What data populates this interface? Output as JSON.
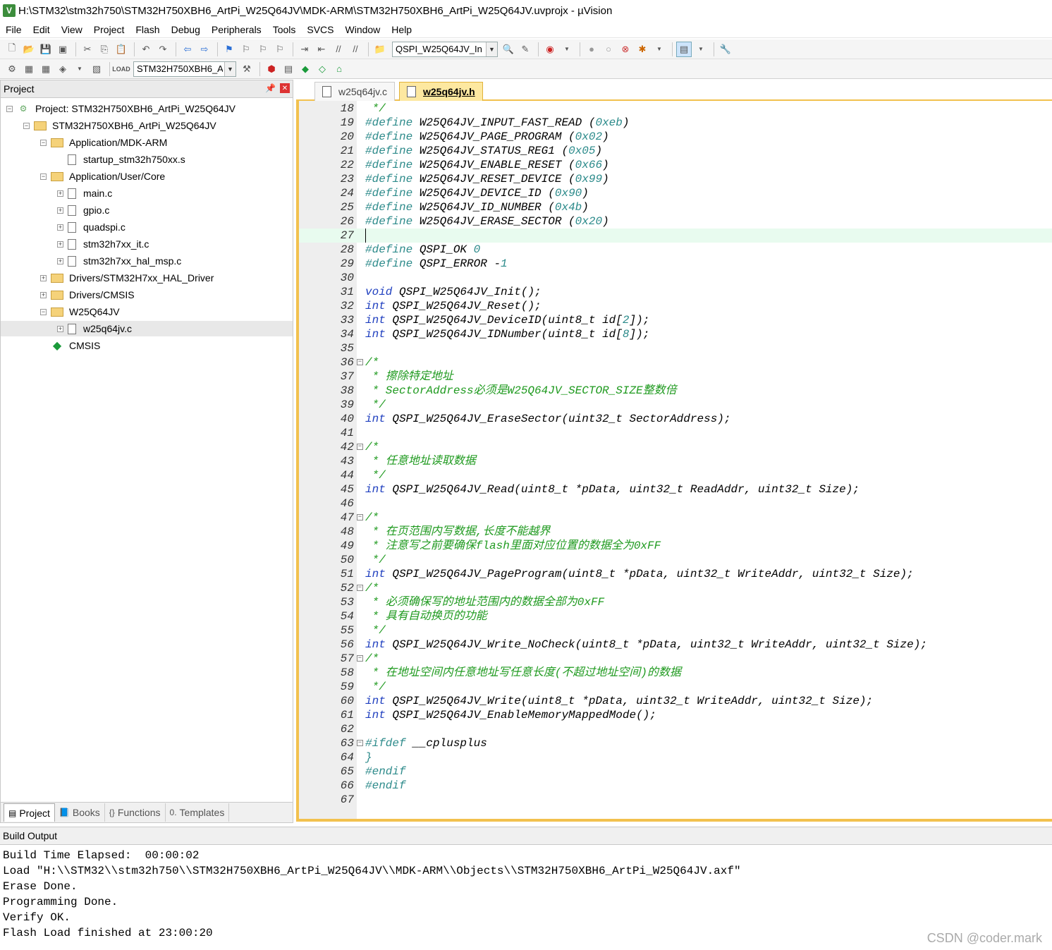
{
  "window": {
    "title": "H:\\STM32\\stm32h750\\STM32H750XBH6_ArtPi_W25Q64JV\\MDK-ARM\\STM32H750XBH6_ArtPi_W25Q64JV.uvprojx - µVision",
    "icon_letter": "V"
  },
  "menu": [
    "File",
    "Edit",
    "View",
    "Project",
    "Flash",
    "Debug",
    "Peripherals",
    "Tools",
    "SVCS",
    "Window",
    "Help"
  ],
  "toolbar": {
    "function_combo": "QSPI_W25Q64JV_In",
    "target_combo": "STM32H750XBH6_A"
  },
  "project_panel": {
    "title": "Project",
    "tree": [
      {
        "label": "Project: STM32H750XBH6_ArtPi_W25Q64JV",
        "type": "project",
        "level": 0,
        "expander": "−"
      },
      {
        "label": "STM32H750XBH6_ArtPi_W25Q64JV",
        "type": "target",
        "level": 1,
        "expander": "−"
      },
      {
        "label": "Application/MDK-ARM",
        "type": "folder",
        "level": 2,
        "expander": "−"
      },
      {
        "label": "startup_stm32h750xx.s",
        "type": "file",
        "level": 3,
        "expander": ""
      },
      {
        "label": "Application/User/Core",
        "type": "folder",
        "level": 2,
        "expander": "−"
      },
      {
        "label": "main.c",
        "type": "file",
        "level": 3,
        "expander": "+"
      },
      {
        "label": "gpio.c",
        "type": "file",
        "level": 3,
        "expander": "+"
      },
      {
        "label": "quadspi.c",
        "type": "file",
        "level": 3,
        "expander": "+"
      },
      {
        "label": "stm32h7xx_it.c",
        "type": "file",
        "level": 3,
        "expander": "+"
      },
      {
        "label": "stm32h7xx_hal_msp.c",
        "type": "file",
        "level": 3,
        "expander": "+"
      },
      {
        "label": "Drivers/STM32H7xx_HAL_Driver",
        "type": "folder",
        "level": 2,
        "expander": "+"
      },
      {
        "label": "Drivers/CMSIS",
        "type": "folder",
        "level": 2,
        "expander": "+"
      },
      {
        "label": "W25Q64JV",
        "type": "folder",
        "level": 2,
        "expander": "−"
      },
      {
        "label": "w25q64jv.c",
        "type": "file",
        "level": 3,
        "expander": "+",
        "selected": true
      },
      {
        "label": "CMSIS",
        "type": "cmsis",
        "level": 2,
        "expander": ""
      }
    ],
    "tabs": [
      {
        "label": "Project",
        "icon": "project-tab-icon",
        "active": true
      },
      {
        "label": "Books",
        "icon": "books-tab-icon",
        "active": false
      },
      {
        "label": "Functions",
        "icon": "functions-tab-icon",
        "active": false
      },
      {
        "label": "Templates",
        "icon": "templates-tab-icon",
        "active": false
      }
    ]
  },
  "editor": {
    "tabs": [
      {
        "label": "w25q64jv.c",
        "active": false
      },
      {
        "label": "w25q64jv.h",
        "active": true
      }
    ],
    "current_line": 27,
    "lines": [
      {
        "n": "18",
        "fold": "",
        "segs": [
          [
            "cm",
            " */"
          ]
        ]
      },
      {
        "n": "19",
        "fold": "",
        "segs": [
          [
            "pp",
            "#define"
          ],
          [
            "tx",
            " W25Q64JV_INPUT_FAST_READ ("
          ],
          [
            "num",
            "0xeb"
          ],
          [
            "tx",
            ")"
          ]
        ]
      },
      {
        "n": "20",
        "fold": "",
        "segs": [
          [
            "pp",
            "#define"
          ],
          [
            "tx",
            " W25Q64JV_PAGE_PROGRAM ("
          ],
          [
            "num",
            "0x02"
          ],
          [
            "tx",
            ")"
          ]
        ]
      },
      {
        "n": "21",
        "fold": "",
        "segs": [
          [
            "pp",
            "#define"
          ],
          [
            "tx",
            " W25Q64JV_STATUS_REG1 ("
          ],
          [
            "num",
            "0x05"
          ],
          [
            "tx",
            ")"
          ]
        ]
      },
      {
        "n": "22",
        "fold": "",
        "segs": [
          [
            "pp",
            "#define"
          ],
          [
            "tx",
            " W25Q64JV_ENABLE_RESET ("
          ],
          [
            "num",
            "0x66"
          ],
          [
            "tx",
            ")"
          ]
        ]
      },
      {
        "n": "23",
        "fold": "",
        "segs": [
          [
            "pp",
            "#define"
          ],
          [
            "tx",
            " W25Q64JV_RESET_DEVICE ("
          ],
          [
            "num",
            "0x99"
          ],
          [
            "tx",
            ")"
          ]
        ]
      },
      {
        "n": "24",
        "fold": "",
        "segs": [
          [
            "pp",
            "#define"
          ],
          [
            "tx",
            " W25Q64JV_DEVICE_ID ("
          ],
          [
            "num",
            "0x90"
          ],
          [
            "tx",
            ")"
          ]
        ]
      },
      {
        "n": "25",
        "fold": "",
        "segs": [
          [
            "pp",
            "#define"
          ],
          [
            "tx",
            " W25Q64JV_ID_NUMBER ("
          ],
          [
            "num",
            "0x4b"
          ],
          [
            "tx",
            ")"
          ]
        ]
      },
      {
        "n": "26",
        "fold": "",
        "segs": [
          [
            "pp",
            "#define"
          ],
          [
            "tx",
            " W25Q64JV_ERASE_SECTOR ("
          ],
          [
            "num",
            "0x20"
          ],
          [
            "tx",
            ")"
          ]
        ]
      },
      {
        "n": "27",
        "fold": "",
        "segs": []
      },
      {
        "n": "28",
        "fold": "",
        "segs": [
          [
            "pp",
            "#define"
          ],
          [
            "tx",
            " QSPI_OK "
          ],
          [
            "num",
            "0"
          ]
        ]
      },
      {
        "n": "29",
        "fold": "",
        "segs": [
          [
            "pp",
            "#define"
          ],
          [
            "tx",
            " QSPI_ERROR -"
          ],
          [
            "num",
            "1"
          ]
        ]
      },
      {
        "n": "30",
        "fold": "",
        "segs": []
      },
      {
        "n": "31",
        "fold": "",
        "segs": [
          [
            "kw",
            "void"
          ],
          [
            "tx",
            " QSPI_W25Q64JV_Init();"
          ]
        ]
      },
      {
        "n": "32",
        "fold": "",
        "segs": [
          [
            "kw",
            "int"
          ],
          [
            "tx",
            " QSPI_W25Q64JV_Reset();"
          ]
        ]
      },
      {
        "n": "33",
        "fold": "",
        "segs": [
          [
            "kw",
            "int"
          ],
          [
            "tx",
            " QSPI_W25Q64JV_DeviceID(uint8_t id["
          ],
          [
            "num",
            "2"
          ],
          [
            "tx",
            "]);"
          ]
        ]
      },
      {
        "n": "34",
        "fold": "",
        "segs": [
          [
            "kw",
            "int"
          ],
          [
            "tx",
            " QSPI_W25Q64JV_IDNumber(uint8_t id["
          ],
          [
            "num",
            "8"
          ],
          [
            "tx",
            "]);"
          ]
        ]
      },
      {
        "n": "35",
        "fold": "",
        "segs": []
      },
      {
        "n": "36",
        "fold": "−",
        "segs": [
          [
            "cm",
            "/*"
          ]
        ]
      },
      {
        "n": "37",
        "fold": "",
        "segs": [
          [
            "cm",
            " * 擦除特定地址"
          ]
        ]
      },
      {
        "n": "38",
        "fold": "",
        "segs": [
          [
            "cm",
            " * SectorAddress必须是W25Q64JV_SECTOR_SIZE整数倍"
          ]
        ]
      },
      {
        "n": "39",
        "fold": "",
        "segs": [
          [
            "cm",
            " */"
          ]
        ]
      },
      {
        "n": "40",
        "fold": "",
        "segs": [
          [
            "kw",
            "int"
          ],
          [
            "tx",
            " QSPI_W25Q64JV_EraseSector(uint32_t SectorAddress);"
          ]
        ]
      },
      {
        "n": "41",
        "fold": "",
        "segs": []
      },
      {
        "n": "42",
        "fold": "−",
        "segs": [
          [
            "cm",
            "/*"
          ]
        ]
      },
      {
        "n": "43",
        "fold": "",
        "segs": [
          [
            "cm",
            " * 任意地址读取数据"
          ]
        ]
      },
      {
        "n": "44",
        "fold": "",
        "segs": [
          [
            "cm",
            " */"
          ]
        ]
      },
      {
        "n": "45",
        "fold": "",
        "segs": [
          [
            "kw",
            "int"
          ],
          [
            "tx",
            " QSPI_W25Q64JV_Read(uint8_t *pData, uint32_t ReadAddr, uint32_t Size);"
          ]
        ]
      },
      {
        "n": "46",
        "fold": "",
        "segs": []
      },
      {
        "n": "47",
        "fold": "−",
        "segs": [
          [
            "cm",
            "/*"
          ]
        ]
      },
      {
        "n": "48",
        "fold": "",
        "segs": [
          [
            "cm",
            " * 在页范围内写数据,长度不能越界"
          ]
        ]
      },
      {
        "n": "49",
        "fold": "",
        "segs": [
          [
            "cm",
            " * 注意写之前要确保flash里面对应位置的数据全为0xFF"
          ]
        ]
      },
      {
        "n": "50",
        "fold": "",
        "segs": [
          [
            "cm",
            " */"
          ]
        ]
      },
      {
        "n": "51",
        "fold": "",
        "segs": [
          [
            "kw",
            "int"
          ],
          [
            "tx",
            " QSPI_W25Q64JV_PageProgram(uint8_t *pData, uint32_t WriteAddr, uint32_t Size);"
          ]
        ]
      },
      {
        "n": "52",
        "fold": "−",
        "segs": [
          [
            "cm",
            "/*"
          ]
        ]
      },
      {
        "n": "53",
        "fold": "",
        "segs": [
          [
            "cm",
            " * 必须确保写的地址范围内的数据全部为0xFF"
          ]
        ]
      },
      {
        "n": "54",
        "fold": "",
        "segs": [
          [
            "cm",
            " * 具有自动换页的功能"
          ]
        ]
      },
      {
        "n": "55",
        "fold": "",
        "segs": [
          [
            "cm",
            " */"
          ]
        ]
      },
      {
        "n": "56",
        "fold": "",
        "segs": [
          [
            "kw",
            "int"
          ],
          [
            "tx",
            " QSPI_W25Q64JV_Write_NoCheck(uint8_t *pData, uint32_t WriteAddr, uint32_t Size);"
          ]
        ]
      },
      {
        "n": "57",
        "fold": "−",
        "segs": [
          [
            "cm",
            "/*"
          ]
        ]
      },
      {
        "n": "58",
        "fold": "",
        "segs": [
          [
            "cm",
            " * 在地址空间内任意地址写任意长度(不超过地址空间)的数据"
          ]
        ]
      },
      {
        "n": "59",
        "fold": "",
        "segs": [
          [
            "cm",
            " */"
          ]
        ]
      },
      {
        "n": "60",
        "fold": "",
        "segs": [
          [
            "kw",
            "int"
          ],
          [
            "tx",
            " QSPI_W25Q64JV_Write(uint8_t *pData, uint32_t WriteAddr, uint32_t Size);"
          ]
        ]
      },
      {
        "n": "61",
        "fold": "",
        "segs": [
          [
            "kw",
            "int"
          ],
          [
            "tx",
            " QSPI_W25Q64JV_EnableMemoryMappedMode();"
          ]
        ]
      },
      {
        "n": "62",
        "fold": "",
        "segs": []
      },
      {
        "n": "63",
        "fold": "−",
        "segs": [
          [
            "pp",
            "#ifdef"
          ],
          [
            "tx",
            " __cplusplus"
          ]
        ]
      },
      {
        "n": "64",
        "fold": "",
        "segs": [
          [
            "pp",
            "}"
          ]
        ]
      },
      {
        "n": "65",
        "fold": "",
        "segs": [
          [
            "pp",
            "#endif"
          ]
        ]
      },
      {
        "n": "66",
        "fold": "",
        "segs": [
          [
            "pp",
            "#endif"
          ]
        ]
      },
      {
        "n": "67",
        "fold": "",
        "segs": []
      }
    ]
  },
  "build_output": {
    "title": "Build Output",
    "lines": [
      "Build Time Elapsed:  00:00:02",
      "Load \"H:\\\\STM32\\\\stm32h750\\\\STM32H750XBH6_ArtPi_W25Q64JV\\\\MDK-ARM\\\\Objects\\\\STM32H750XBH6_ArtPi_W25Q64JV.axf\"",
      "Erase Done.",
      "Programming Done.",
      "Verify OK.",
      "Flash Load finished at 23:00:20"
    ]
  },
  "watermark": "CSDN @coder.mark"
}
